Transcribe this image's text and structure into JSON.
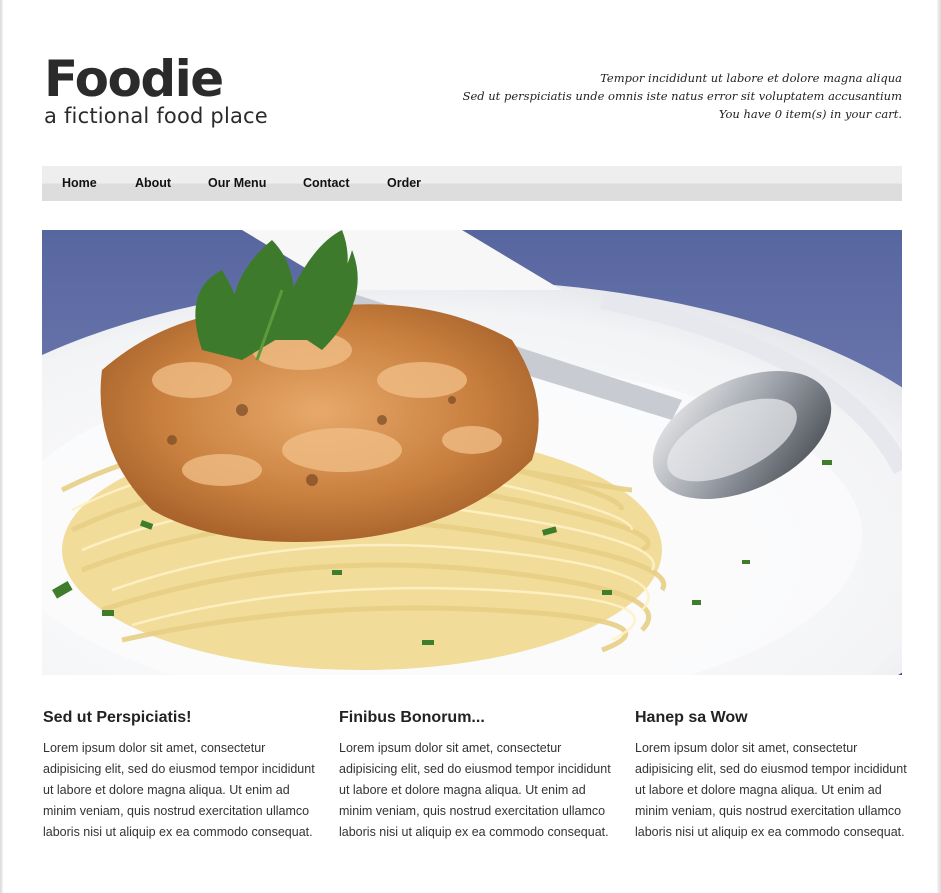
{
  "header": {
    "logo_title": "Foodie",
    "logo_tagline": "a fictional food place",
    "info_line_1": "Tempor incididunt ut labore et dolore magna aliqua",
    "info_line_2": "Sed ut perspiciatis unde omnis iste natus error sit voluptatem accusantium",
    "cart_text": "You have 0 item(s) in your cart."
  },
  "nav": {
    "items": [
      {
        "label": "Home"
      },
      {
        "label": "About"
      },
      {
        "label": "Our Menu"
      },
      {
        "label": "Contact"
      },
      {
        "label": "Order"
      }
    ]
  },
  "hero": {
    "description_icon": "pasta-dish-photo"
  },
  "columns": [
    {
      "title": "Sed ut Perspiciatis!",
      "body": "Lorem ipsum dolor sit amet, consectetur adipisicing elit, sed do eiusmod tempor incididunt ut labore et dolore magna aliqua. Ut enim ad minim veniam, quis nostrud exercitation ullamco laboris nisi ut aliquip ex ea commodo consequat."
    },
    {
      "title": "Finibus Bonorum...",
      "body": "Lorem ipsum dolor sit amet, consectetur adipisicing elit, sed do eiusmod tempor incididunt ut labore et dolore magna aliqua. Ut enim ad minim veniam, quis nostrud exercitation ullamco laboris nisi ut aliquip ex ea commodo consequat."
    },
    {
      "title": "Hanep sa Wow",
      "body": "Lorem ipsum dolor sit amet, consectetur adipisicing elit, sed do eiusmod tempor incididunt ut labore et dolore magna aliqua. Ut enim ad minim veniam, quis nostrud exercitation ullamco laboris nisi ut aliquip ex ea commodo consequat."
    }
  ],
  "colors": {
    "nav_light": "#eeeeee",
    "nav_dark": "#dddddd",
    "text": "#222222",
    "tablecloth": "#5a6aa0"
  }
}
